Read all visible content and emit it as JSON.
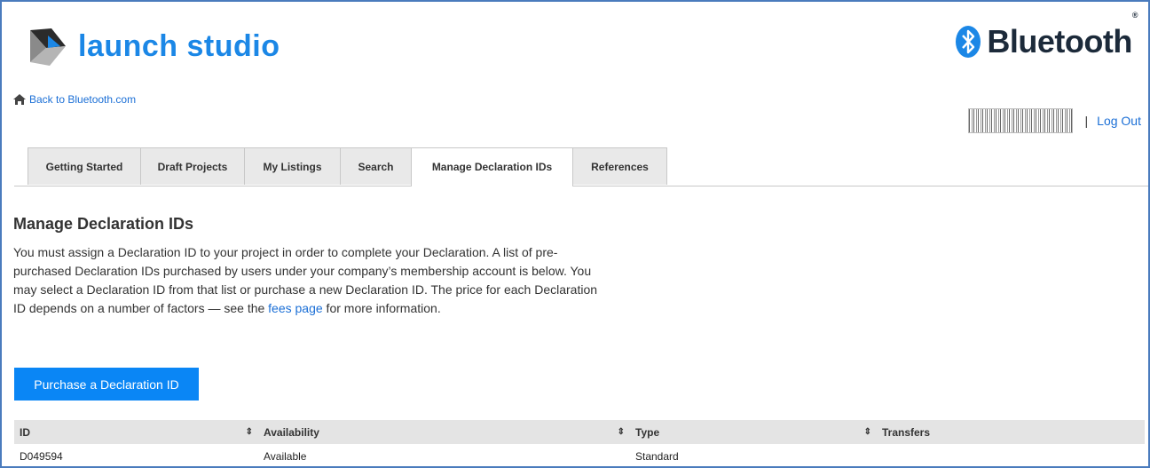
{
  "header": {
    "app_name": "launch studio",
    "brand": "Bluetooth",
    "brand_mark": "®",
    "back_link": "Back to Bluetooth.com",
    "separator": "|",
    "logout": "Log Out"
  },
  "tabs": [
    {
      "label": "Getting Started",
      "active": false
    },
    {
      "label": "Draft Projects",
      "active": false
    },
    {
      "label": "My Listings",
      "active": false
    },
    {
      "label": "Search",
      "active": false
    },
    {
      "label": "Manage Declaration IDs",
      "active": true
    },
    {
      "label": "References",
      "active": false
    }
  ],
  "main": {
    "title": "Manage Declaration IDs",
    "description_before_link": "You must assign a Declaration ID to your project in order to complete your Declaration. A list of pre-purchased Declaration IDs purchased by users under your company’s membership account is below. You may select a Declaration ID from that list or purchase a new Declaration ID. The price for each Declaration ID depends on a number of factors — see the ",
    "fees_link": "fees page",
    "description_after_link": " for more information.",
    "purchase_button": "Purchase a Declaration ID"
  },
  "table": {
    "columns": [
      "ID",
      "Availability",
      "Type",
      "Transfers"
    ],
    "sort_icon": "⇕",
    "rows": [
      {
        "id": "D049594",
        "availability": "Available",
        "type": "Standard",
        "transfers": ""
      }
    ]
  },
  "colors": {
    "accent": "#1b87e6",
    "button": "#0a86f5",
    "link": "#1b6fd6",
    "frame": "#4a7bbd",
    "highlight_line": "#e2202a"
  },
  "icons": {
    "logo": "launch-studio-logo-icon",
    "bluetooth": "bluetooth-icon",
    "home": "home-icon",
    "sort": "sort-icon"
  }
}
